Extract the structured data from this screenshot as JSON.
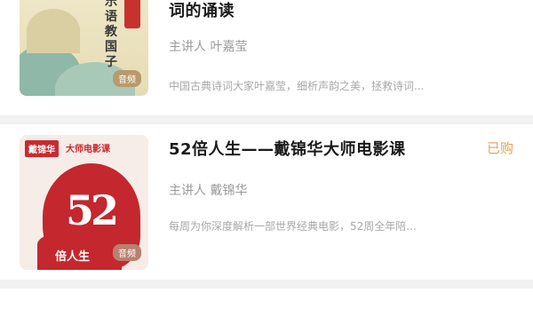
{
  "courses": [
    {
      "title": "词的诵读",
      "lecturer": "主讲人 叶嘉莹",
      "description": "中国古典诗词大家叶嘉莹，细析声韵之美，拯救诗词...",
      "cover": {
        "title": "乐语教国子",
        "badge": "音频"
      }
    },
    {
      "title": "52倍人生——戴锦华大师电影课",
      "lecturer": "主讲人 戴锦华",
      "description": "每周为你深度解析一部世界经典电影，52周全年陪...",
      "status": "已购",
      "cover": {
        "brand": "戴锦华",
        "series": "大师电影课",
        "number": "52",
        "subtitle": "倍人生",
        "badge": "音频"
      }
    }
  ],
  "colors": {
    "accent": "#e0a35a",
    "brand_red": "#c4272d"
  }
}
